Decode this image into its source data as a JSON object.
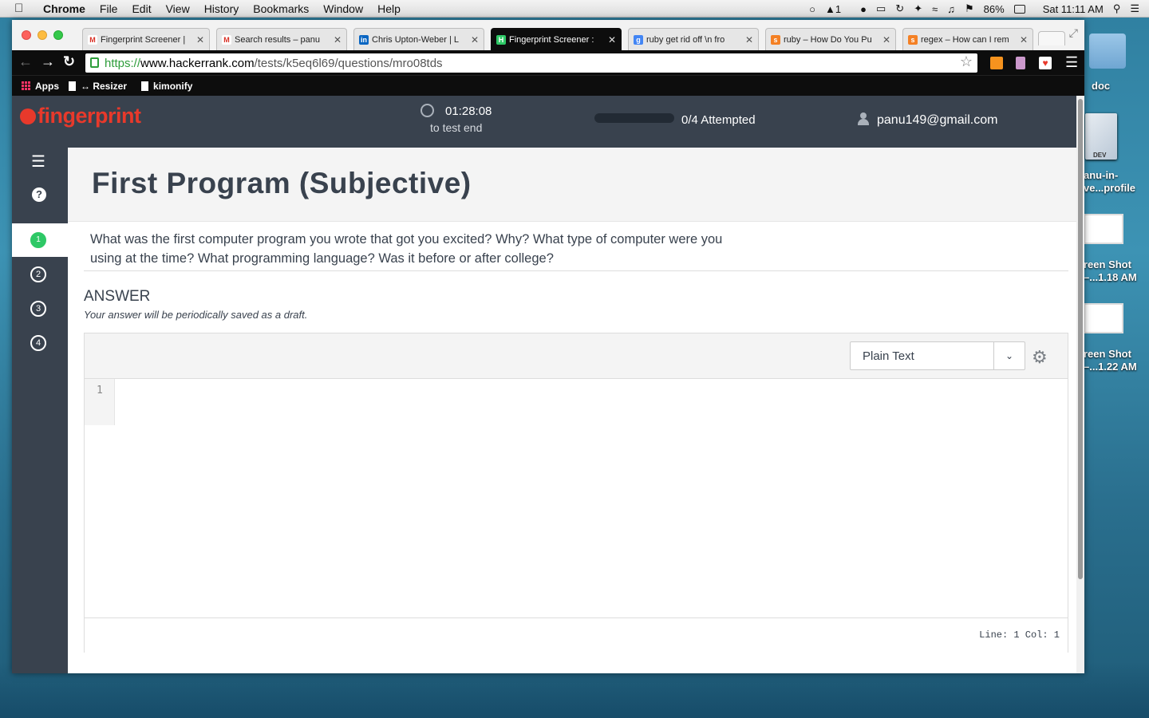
{
  "menubar": {
    "app": "Chrome",
    "items": [
      "File",
      "Edit",
      "View",
      "History",
      "Bookmarks",
      "Window",
      "Help"
    ],
    "battery": "86%",
    "clock": "Sat 11:11 AM",
    "notif_count": "1"
  },
  "tabs": [
    {
      "title": "Fingerprint Screener | ",
      "favicon": "gmail-icon",
      "color": "#d93025"
    },
    {
      "title": "Search results – panu",
      "favicon": "gmail-icon",
      "color": "#d93025"
    },
    {
      "title": "Chris Upton-Weber | L",
      "favicon": "linkedin-icon",
      "color": "#0a66c2"
    },
    {
      "title": "Fingerprint Screener :",
      "favicon": "hackerrank-icon",
      "color": "#2ec866"
    },
    {
      "title": "ruby get rid off \\n fro",
      "favicon": "google-icon",
      "color": "#4285f4"
    },
    {
      "title": "ruby – How Do You Pu",
      "favicon": "stackoverflow-icon",
      "color": "#f48024"
    },
    {
      "title": "regex – How can I rem",
      "favicon": "stackoverflow-icon",
      "color": "#f48024"
    }
  ],
  "omnibox": {
    "scheme": "https://",
    "host": "www.hackerrank.com",
    "path": "/tests/k5eq6l69/questions/mro08tds"
  },
  "bookmarks": [
    "Apps",
    "↔ Resizer",
    "kimonify"
  ],
  "header": {
    "logo": "fingerprint",
    "timer": "01:28:08",
    "timer_sub": "to test end",
    "progress_fraction": 0,
    "attempted": "0/4 Attempted",
    "user": "panu149@gmail.com"
  },
  "sidebar": {
    "questions": [
      "1",
      "2",
      "3",
      "4"
    ],
    "active": "1",
    "help": "?"
  },
  "question": {
    "title": "First Program (Subjective)",
    "text": "What was the first computer program you wrote that got you excited? Why? What type of computer were you using at the time? What programming language?  Was it before or after college?"
  },
  "answer": {
    "label": "ANSWER",
    "hint": "Your answer will be periodically saved as a draft.",
    "language": "Plain Text",
    "line_number": "1",
    "status": "Line: 1 Col: 1"
  },
  "desktop": {
    "icons": [
      "doc",
      "anu-in-\nve...profile",
      "reen Shot\n–...1.18 AM",
      "reen Shot\n–...1.22 AM"
    ],
    "dev_badge": "DEV"
  },
  "colors": {
    "brand": "#e8392b",
    "header_bg": "#39424e",
    "active_green": "#2ec866"
  }
}
